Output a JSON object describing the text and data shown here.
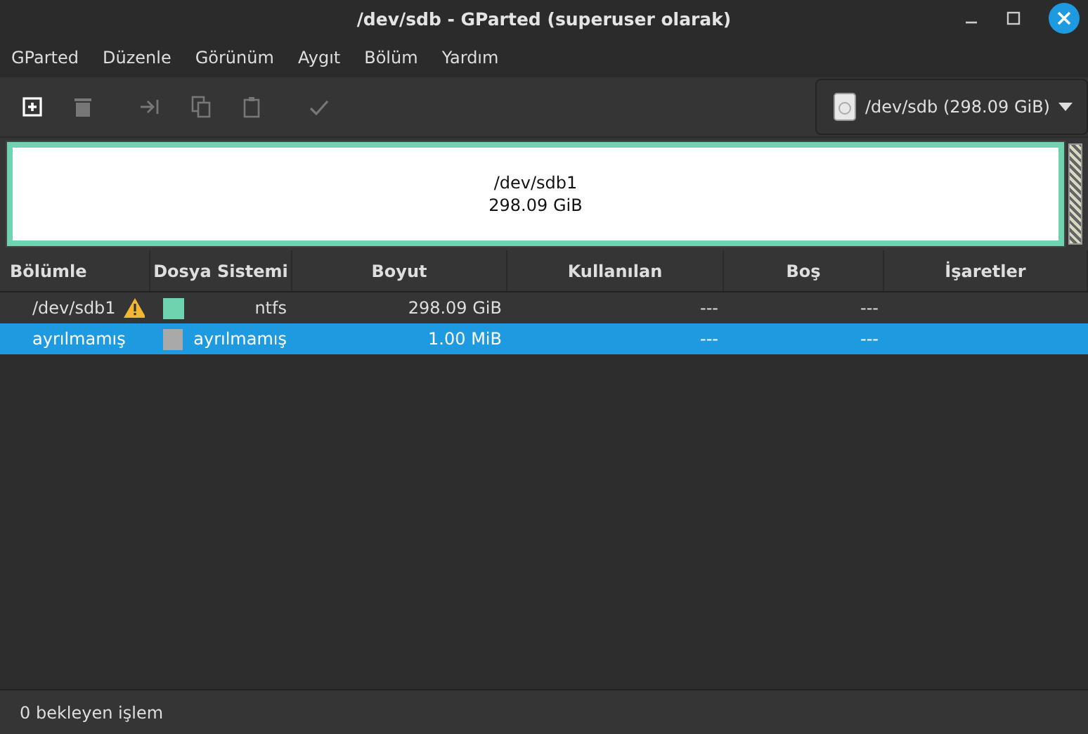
{
  "window": {
    "title": "/dev/sdb - GParted (superuser olarak)"
  },
  "menu": [
    "GParted",
    "Düzenle",
    "Görünüm",
    "Aygıt",
    "Bölüm",
    "Yardım"
  ],
  "toolbar": [
    {
      "kind": "new",
      "disabled": false
    },
    {
      "kind": "delete",
      "disabled": true
    },
    {
      "kind": "resize",
      "disabled": true
    },
    {
      "kind": "copy",
      "disabled": true
    },
    {
      "kind": "paste",
      "disabled": true
    },
    {
      "kind": "apply",
      "disabled": true
    }
  ],
  "device": {
    "label": "/dev/sdb (298.09 GiB)"
  },
  "map": {
    "name": "/dev/sdb1",
    "size": "298.09 GiB"
  },
  "table": {
    "columns": [
      "Bölümle",
      "Dosya Sistemi",
      "Boyut",
      "Kullanılan",
      "Boş",
      "İşaretler"
    ],
    "rows": [
      {
        "name": "/dev/sdb1",
        "warning": true,
        "color": "#70d3b0",
        "fs": "ntfs",
        "size": "298.09 GiB",
        "used": "---",
        "free": "---",
        "selected": false
      },
      {
        "name": "ayrılmamış",
        "warning": false,
        "color": "#a9a9a9",
        "fs": "ayrılmamış",
        "size": "1.00 MiB",
        "used": "---",
        "free": "---",
        "selected": true
      }
    ]
  },
  "status_bar": "0 bekleyen işlem"
}
